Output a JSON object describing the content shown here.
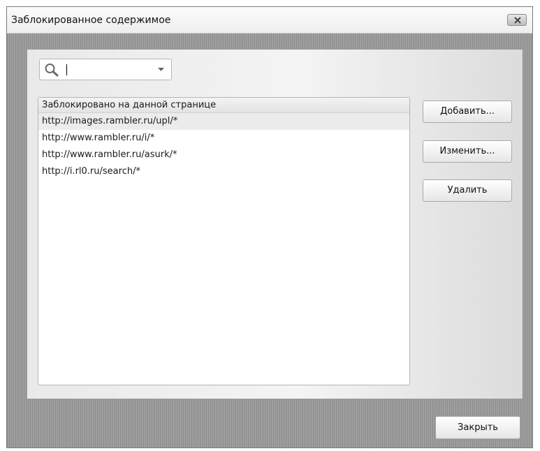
{
  "window": {
    "title": "Заблокированное содержимое"
  },
  "search": {
    "value": "",
    "icon": "magnifier"
  },
  "list": {
    "header": "Заблокировано на данной странице",
    "items": [
      "http://images.rambler.ru/upl/*",
      "http://www.rambler.ru/i/*",
      "http://www.rambler.ru/asurk/*",
      "http://i.rl0.ru/search/*"
    ],
    "selected_index": 0
  },
  "buttons": {
    "add": "Добавить...",
    "edit": "Изменить...",
    "delete": "Удалить",
    "close": "Закрыть"
  }
}
